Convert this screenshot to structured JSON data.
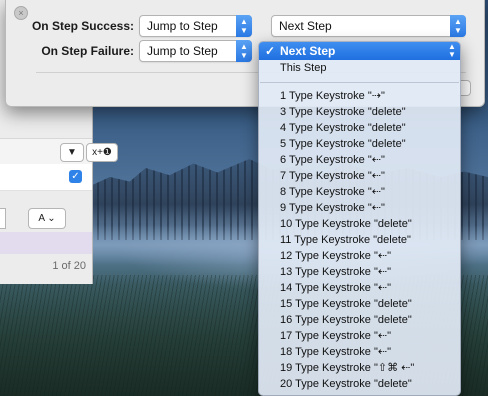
{
  "dialog": {
    "success_label": "On Step Success:",
    "success_action": "Jump to Step",
    "success_target": "Next Step",
    "failure_label": "On Step Failure:",
    "failure_action": "Jump to Step"
  },
  "menu": {
    "selected": "Next Step",
    "check_mark": "✓",
    "this_step": "This Step",
    "items": [
      "1 Type Keystroke \"⇢\"",
      "3 Type Keystroke \"delete\"",
      "4 Type Keystroke \"delete\"",
      "5 Type Keystroke \"delete\"",
      "6 Type Keystroke \"⇠\"",
      "7 Type Keystroke \"⇠\"",
      "8 Type Keystroke \"⇠\"",
      "9 Type Keystroke \"⇠\"",
      "10 Type Keystroke \"delete\"",
      "11 Type Keystroke \"delete\"",
      "12 Type Keystroke \"⇠\"",
      "13 Type Keystroke \"⇠\"",
      "14 Type Keystroke \"⇠\"",
      "15 Type Keystroke \"delete\"",
      "16 Type Keystroke \"delete\"",
      "17 Type Keystroke \"⇠\"",
      "18 Type Keystroke \"⇠\"",
      "19 Type Keystroke \"⇧⌘ ⇠\"",
      "20 Type Keystroke \"delete\""
    ]
  },
  "background_window": {
    "toolbar_button_glyph": "▼",
    "insert_button": "x+❶",
    "checkbox_glyph": "✓",
    "format_button": "A ⌄",
    "pager": "1 of 20"
  },
  "colors": {
    "accent": "#2a78e4",
    "menu_highlight": "#1f6fe0",
    "menu_background": "#e1e9f5",
    "sheet_background": "#ececec"
  }
}
